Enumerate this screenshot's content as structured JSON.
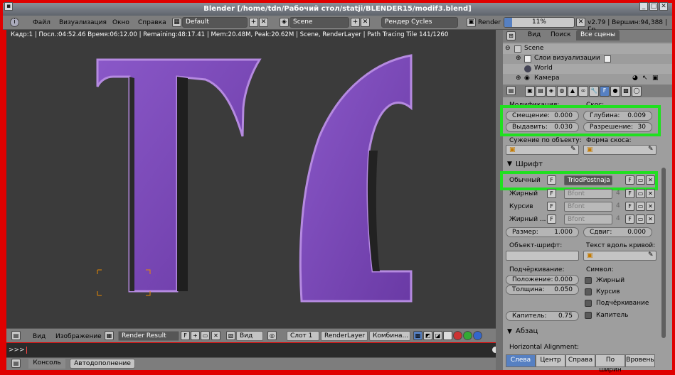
{
  "window": {
    "title": "Blender [/home/tdn/Рабочий стол/statji/BLENDER15/modif3.blend]"
  },
  "header": {
    "menus": [
      "Файл",
      "Визуализация",
      "Окно",
      "Справка"
    ],
    "layout": "Default",
    "scene": "Scene",
    "engine": "Рендер Cycles",
    "render_label": "Render",
    "progress_text": "11%",
    "progress": 0.11,
    "version_info": "v2.79 | Вершин:94,388 | Гр"
  },
  "viewport": {
    "status": "Кадр:1 | Посл.:04:52.46 Время:06:12.00 | Remaining:48:17.41 | Mem:20.48M, Peak:20.62M | Scene, RenderLayer | Path Tracing Tile 141/1260"
  },
  "image_editor": {
    "view": "Вид",
    "image_menu": "Изображение",
    "image_name": "Render Result",
    "f_label": "F",
    "view_select": "Вид",
    "slot": "Слот 1",
    "layer": "RenderLayer",
    "pass": "Комбина..."
  },
  "console": {
    "prompt": ">>> ",
    "tab_console": "Консоль",
    "tab_autocomplete": "Автодополнение"
  },
  "outliner": {
    "tabs": [
      "Вид",
      "Поиск",
      "Все сцены"
    ],
    "items": [
      "Scene",
      "Слои визуализации",
      "World",
      "Камера"
    ]
  },
  "props": {
    "modification_label": "Модификация:",
    "bevel_label": "Скос:",
    "offset": {
      "label": "Смещение:",
      "value": "0.000"
    },
    "depth": {
      "label": "Глубина:",
      "value": "0.009"
    },
    "extrude": {
      "label": "Выдавить:",
      "value": "0.030"
    },
    "resolution": {
      "label": "Разрешение:",
      "value": "30"
    },
    "taper_label": "Сужение по объекту:",
    "bevel_obj_label": "Форма скоса:",
    "font_section": "Шрифт",
    "fonts": [
      {
        "label": "Обычный",
        "name": "TriodPostnaja",
        "users": ""
      },
      {
        "label": "Жирный",
        "name": "Bfont",
        "users": "4"
      },
      {
        "label": "Курсив",
        "name": "Bfont",
        "users": "4"
      },
      {
        "label": "Жирный ...",
        "name": "Bfont",
        "users": "4"
      }
    ],
    "f_label": "F",
    "size": {
      "label": "Размер:",
      "value": "1.000"
    },
    "shear": {
      "label": "Сдвиг:",
      "value": "0.000"
    },
    "object_font_label": "Объект-шрифт:",
    "text_on_curve_label": "Текст вдоль кривой:",
    "underline_label": "Подчёркивание:",
    "symbol_label": "Символ:",
    "position": {
      "label": "Положение:",
      "value": "0.000"
    },
    "thickness": {
      "label": "Толщина:",
      "value": "0.050"
    },
    "bold": "Жирный",
    "italic": "Курсив",
    "underline": "Подчёркивание",
    "smallcaps_chk": "Капитель",
    "smallcaps": {
      "label": "Капитель:",
      "value": "0.75"
    },
    "paragraph_section": "Абзац",
    "halign_label": "Horizontal Alignment:",
    "align_buttons": [
      "Слева",
      "Центр",
      "Справа",
      "По ширин",
      "Вровень"
    ]
  },
  "colors": {
    "frame": "#e00000",
    "highlight": "#20e020",
    "letter": "#7a45b5",
    "selected": "#5680c2"
  }
}
